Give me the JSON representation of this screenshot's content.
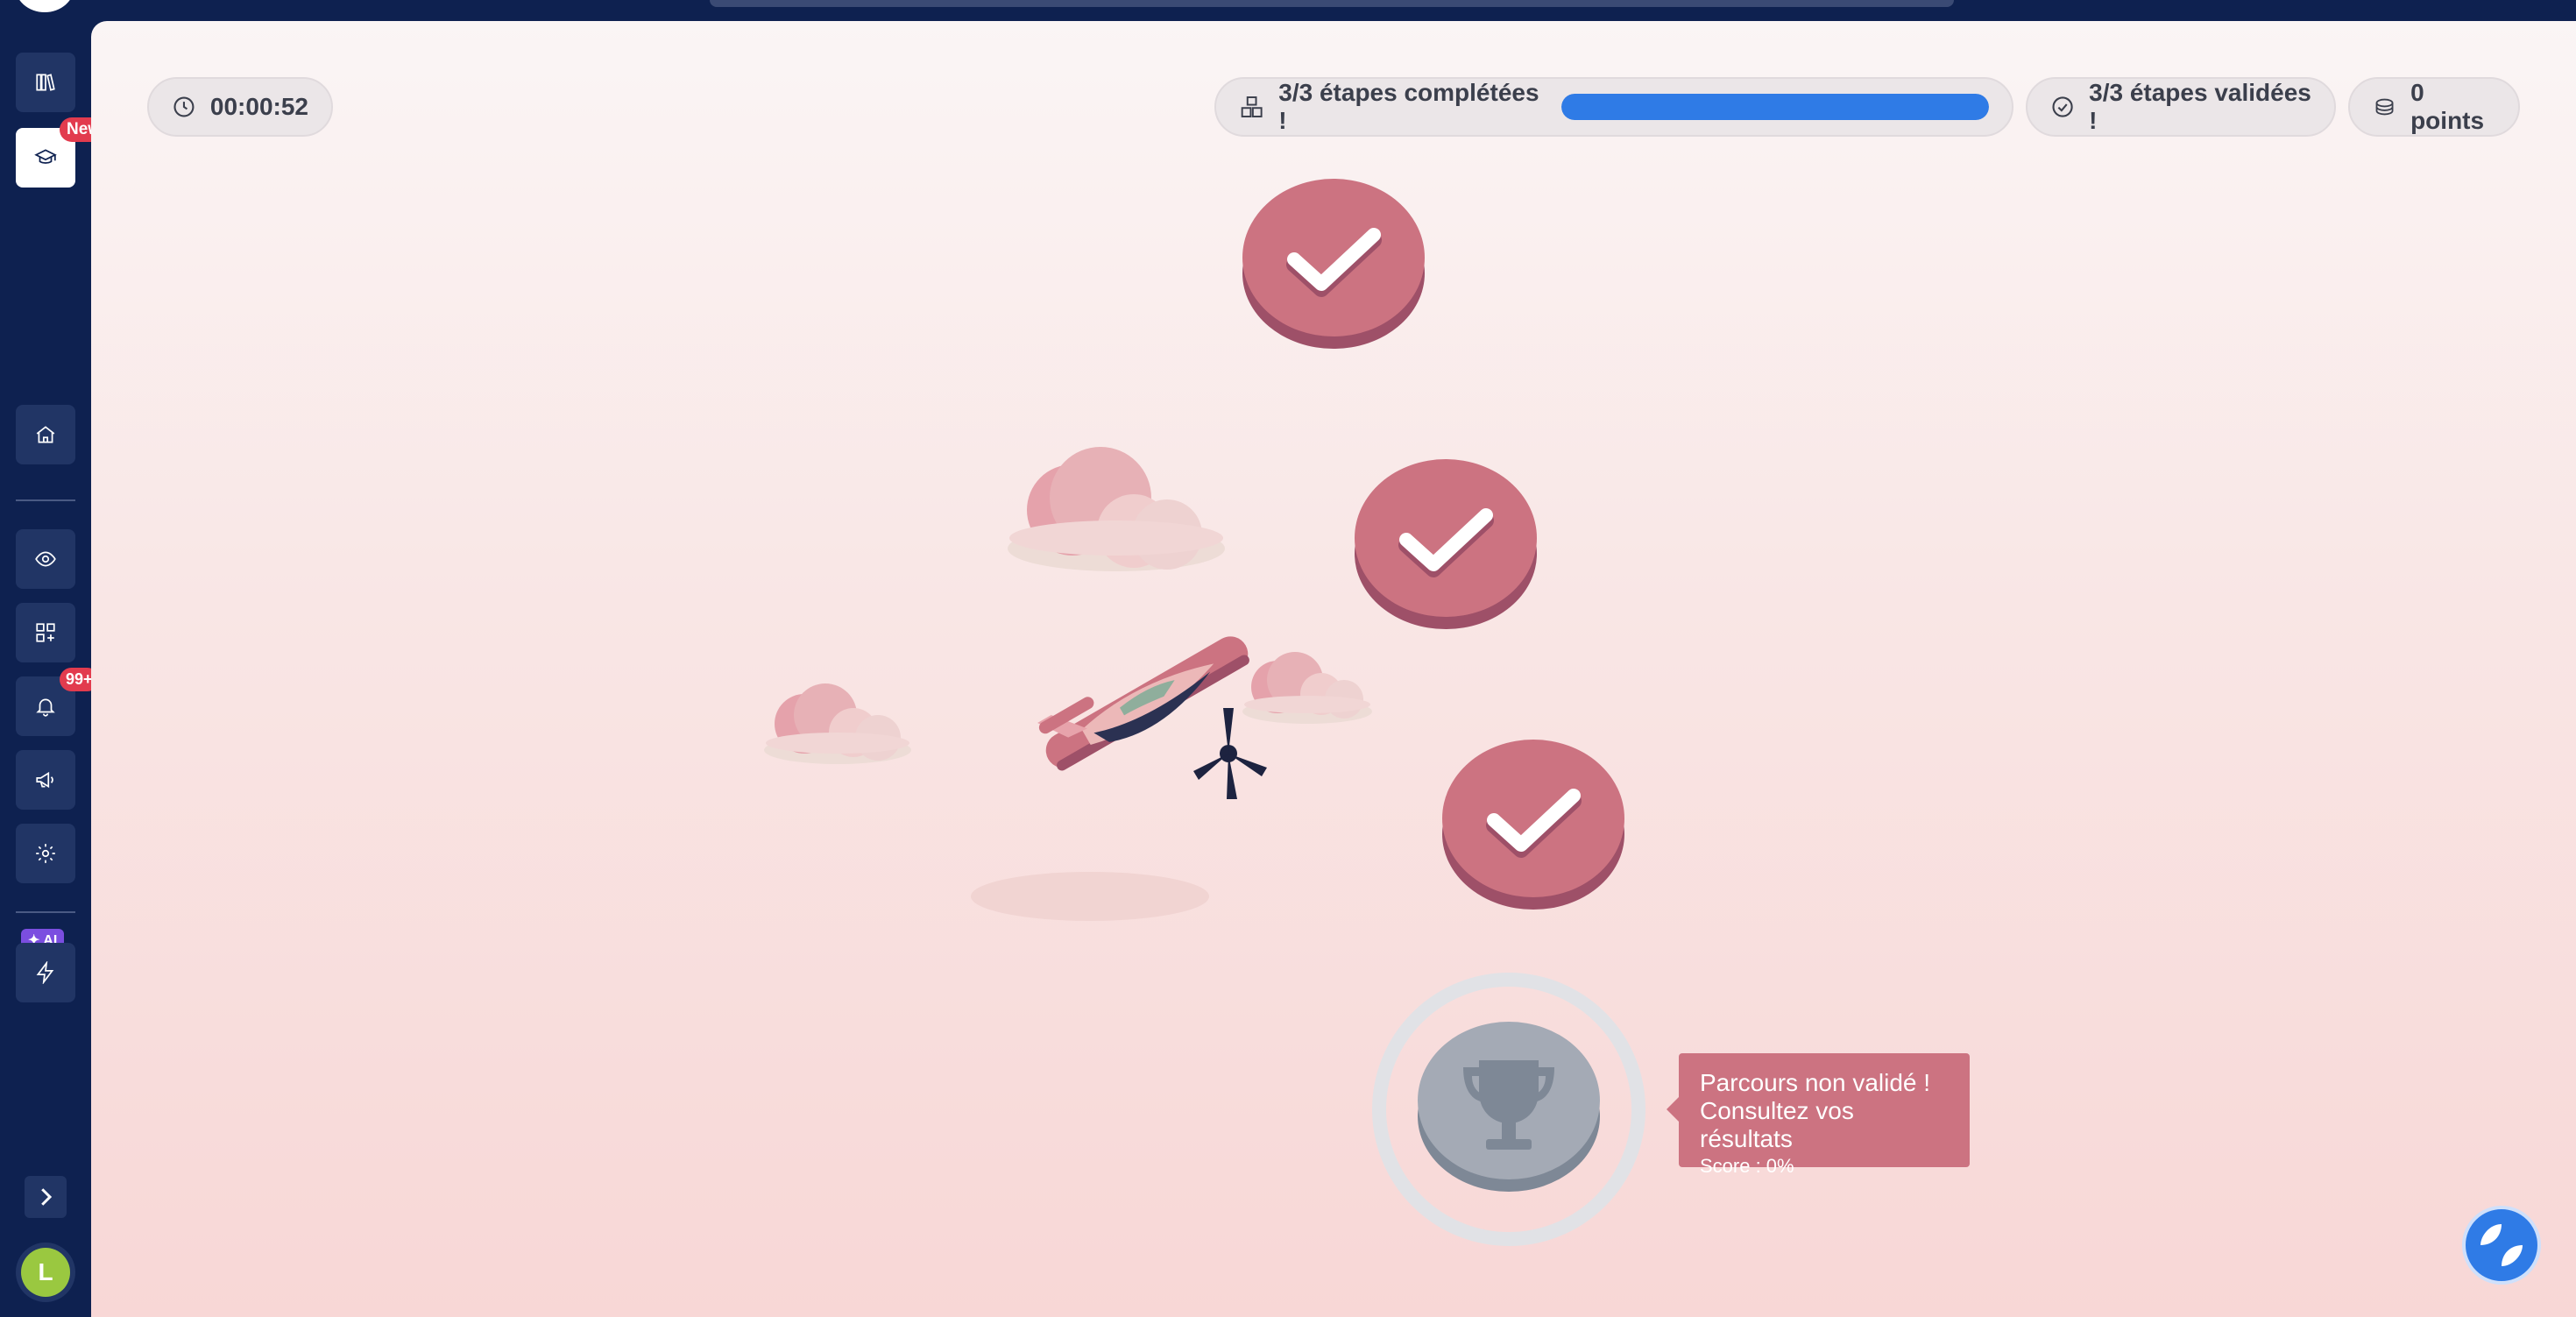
{
  "timer": {
    "value": "00:00:52"
  },
  "progress": {
    "completed_label": "3/3 étapes complétées !",
    "completed_fraction": 1.0,
    "validated_label": "3/3 étapes validées !",
    "points_label": "0 points"
  },
  "sidebar": {
    "new_badge": "New",
    "notifications_badge": "99+",
    "ai_badge": "AI",
    "avatar_initial": "L"
  },
  "steps": [
    {
      "state": "completed",
      "icon": "check-icon"
    },
    {
      "state": "completed",
      "icon": "check-icon"
    },
    {
      "state": "completed",
      "icon": "check-icon"
    }
  ],
  "trophy": {
    "state": "not-validated",
    "icon": "trophy-icon"
  },
  "tooltip": {
    "line1": "Parcours non validé !",
    "line2": "Consultez vos résultats",
    "score": "Score : 0%"
  },
  "colors": {
    "sidebar_bg": "#0e2150",
    "accent_blue": "#2f7be6",
    "step_pink": "#cc7381",
    "trophy_gray": "#a4aab5",
    "badge_red": "#e23b4e",
    "ai_purple": "#7b4ee0",
    "avatar_green": "#9ac840"
  }
}
